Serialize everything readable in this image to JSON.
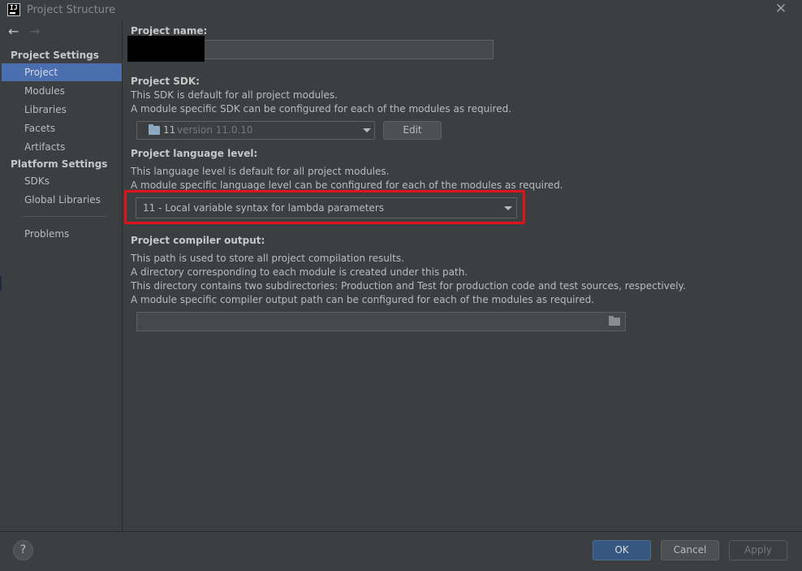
{
  "window": {
    "title": "Project Structure",
    "app_icon_label": "IJ",
    "close_glyph": "✕"
  },
  "nav": {
    "back_glyph": "←",
    "forward_glyph": "→"
  },
  "sidebar": {
    "project_settings_title": "Project Settings",
    "project_settings_items": [
      "Project",
      "Modules",
      "Libraries",
      "Facets",
      "Artifacts"
    ],
    "platform_settings_title": "Platform Settings",
    "platform_settings_items": [
      "SDKs",
      "Global Libraries"
    ],
    "problems": "Problems",
    "selected": "Project"
  },
  "project_name": {
    "label": "Project name:"
  },
  "project_sdk": {
    "label": "Project SDK:",
    "line1": "This SDK is default for all project modules.",
    "line2": "A module specific SDK can be configured for each of the modules as required.",
    "selected_number": "11",
    "selected_version": "version 11.0.10",
    "edit_label": "Edit"
  },
  "language_level": {
    "label": "Project language level:",
    "line1": "This language level is default for all project modules.",
    "line2": "A module specific language level can be configured for each of the modules as required.",
    "selected": "11 - Local variable syntax for lambda parameters",
    "highlight_color": "#e0121a"
  },
  "compiler_output": {
    "label": "Project compiler output:",
    "line1": "This path is used to store all project compilation results.",
    "line2": "A directory corresponding to each module is created under this path.",
    "line3": "This directory contains two subdirectories: Production and Test for production code and test sources, respectively.",
    "line4": "A module specific compiler output path can be configured for each of the modules as required.",
    "value": ""
  },
  "footer": {
    "help_glyph": "?",
    "ok_label": "OK",
    "cancel_label": "Cancel",
    "apply_label": "Apply"
  },
  "colors": {
    "background": "#3c3f41",
    "selection": "#4b6eaf",
    "primary_button": "#365880"
  }
}
